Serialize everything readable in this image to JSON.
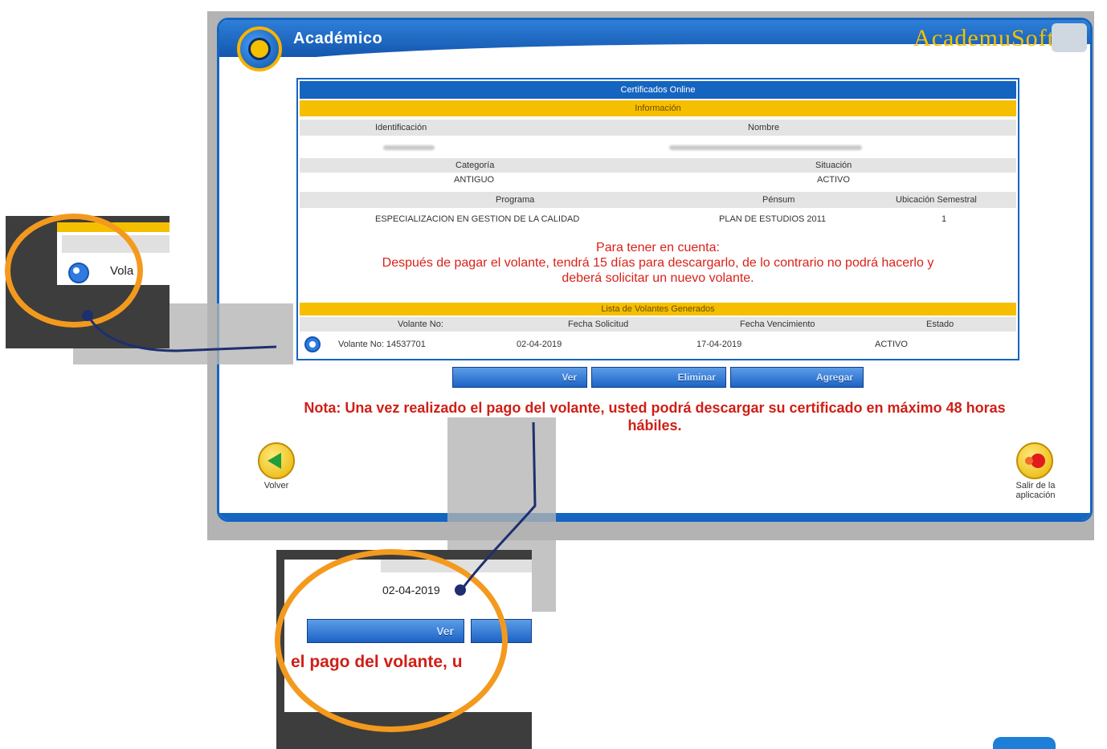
{
  "header": {
    "title": "Académico",
    "brand": "AcademuSoft"
  },
  "certificates": {
    "title": "Certificados Online",
    "info_section": "Información",
    "fields": {
      "identificacion_label": "Identificación",
      "nombre_label": "Nombre",
      "categoria_label": "Categoría",
      "categoria_value": "ANTIGUO",
      "situacion_label": "Situación",
      "situacion_value": "ACTIVO",
      "programa_label": "Programa",
      "programa_value": "ESPECIALIZACION EN GESTION DE LA CALIDAD",
      "pensum_label": "Pénsum",
      "pensum_value": "PLAN DE ESTUDIOS 2011",
      "ubicacion_label": "Ubicación Semestral",
      "ubicacion_value": "1"
    },
    "notice": {
      "title": "Para tener en cuenta:",
      "line1": "Después de pagar el volante, tendrá 15 días para descargarlo, de lo contrario no podrá hacerlo y",
      "line2": "deberá solicitar un nuevo volante."
    },
    "list_section": "Lista de Volantes Generados",
    "columns": [
      "Volante No:",
      "Fecha Solicitud",
      "Fecha Vencimiento",
      "Estado"
    ],
    "rows": [
      {
        "volante": "Volante No: 14537701",
        "solicitud": "02-04-2019",
        "vencimiento": "17-04-2019",
        "estado": "ACTIVO"
      }
    ]
  },
  "buttons": {
    "ver": "Ver",
    "eliminar": "Eliminar",
    "agregar": "Agregar"
  },
  "bottom_note": {
    "line1": "Nota: Una vez realizado el pago del volante, usted podrá descargar su certificado en máximo 48 horas",
    "line2": "hábiles."
  },
  "nav": {
    "back_label": "Volver",
    "exit_line1": "Salir de la",
    "exit_line2": "aplicación"
  },
  "zoom_left": {
    "fragment": "Vola"
  },
  "zoom_bottom": {
    "date": "02-04-2019",
    "button": "Ver",
    "fragment": "el pago del volante, u"
  },
  "colors": {
    "primary_blue": "#1565c0",
    "section_yellow": "#f5bf00",
    "alert_red": "#d9221a",
    "highlight_orange": "#f39a1e"
  }
}
